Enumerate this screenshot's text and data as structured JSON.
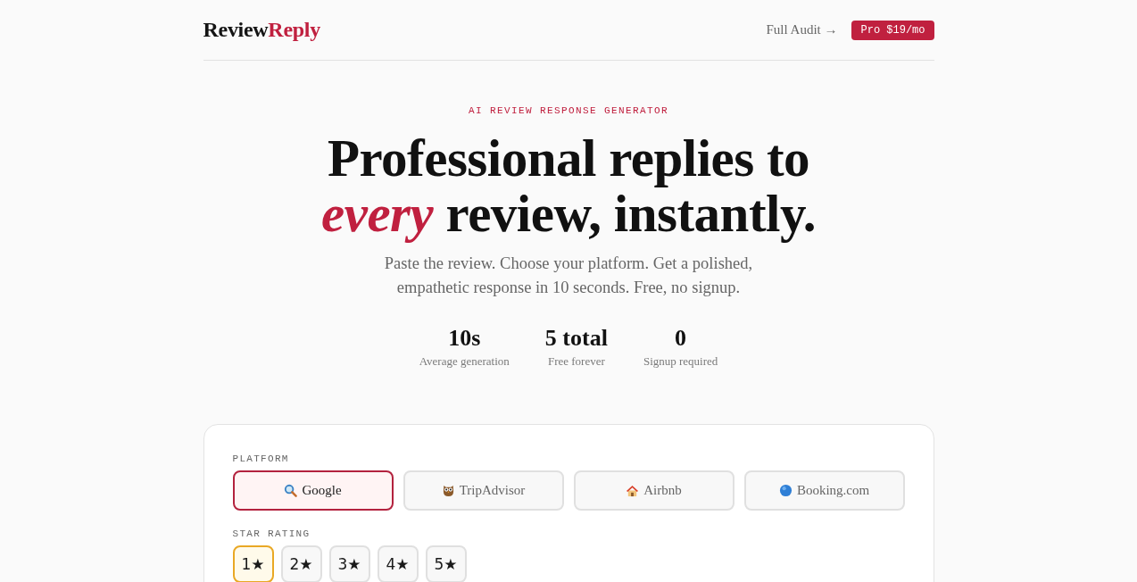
{
  "header": {
    "logo": {
      "text": "Review",
      "accent": "Reply"
    },
    "link": "Full Audit →",
    "pro_button": "Pro $19/mo"
  },
  "hero": {
    "eyebrow": "AI REVIEW RESPONSE GENERATOR",
    "headline": "Professional replies to *every* review, instantly.",
    "subtitle": "Paste the review. Choose your platform. Get a polished, empathetic response in 10 seconds. Free, no signup.",
    "stats": [
      {
        "value": "10s",
        "label": "Average generation"
      },
      {
        "value": "5 total",
        "label": "Free forever"
      },
      {
        "value": "0",
        "label": "Signup required"
      }
    ]
  },
  "form": {
    "platform_label": "PLATFORM",
    "platforms": [
      {
        "label": "Google",
        "selected": true
      },
      {
        "label": "TripAdvisor",
        "selected": false
      },
      {
        "label": "Airbnb",
        "selected": false
      },
      {
        "label": "Booking.com",
        "selected": false
      }
    ],
    "rating_label": "STAR RATING",
    "ratings": [
      {
        "label": "1★",
        "selected": true
      },
      {
        "label": "2★",
        "selected": false
      },
      {
        "label": "3★",
        "selected": false
      },
      {
        "label": "4★",
        "selected": false
      },
      {
        "label": "5★",
        "selected": false
      }
    ]
  }
}
